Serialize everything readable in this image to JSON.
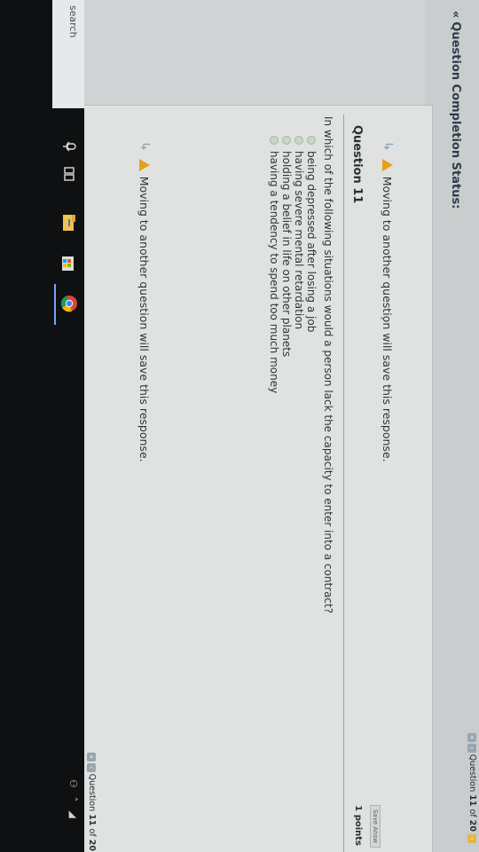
{
  "status_header": {
    "arrows": "«",
    "label": "Question Completion Status:"
  },
  "warning_text": "Moving to another question will save this response.",
  "navigation": {
    "question_label": "Question",
    "current": "11",
    "of_label": "of",
    "total": "20"
  },
  "question": {
    "title": "Question 11",
    "points": "1 points",
    "save_label": "Save Answ",
    "text": "In which of the following situations would a person lack the capacity to enter into a contract?",
    "answers": [
      "being depressed after losing a job",
      "having severe mental retardation",
      "holding a belief in life on other planets",
      "having a tendency to spend too much money"
    ]
  },
  "taskbar": {
    "search_label": "search"
  },
  "colors": {
    "warning": "#e4a11b",
    "radio": "#c8d8c8",
    "next_button": "#e3b54b"
  }
}
